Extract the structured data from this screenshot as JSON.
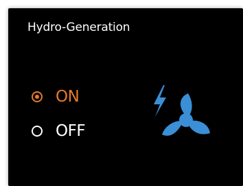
{
  "panel": {
    "title": "Hydro-Generation"
  },
  "options": [
    {
      "label": "ON",
      "selected": true
    },
    {
      "label": "OFF",
      "selected": false
    }
  ],
  "icon": {
    "name": "hydro-fan-bolt-icon",
    "color": "#3a8fd6"
  },
  "colors": {
    "accent": "#e8792c",
    "background": "#000000",
    "text": "#ffffff"
  }
}
